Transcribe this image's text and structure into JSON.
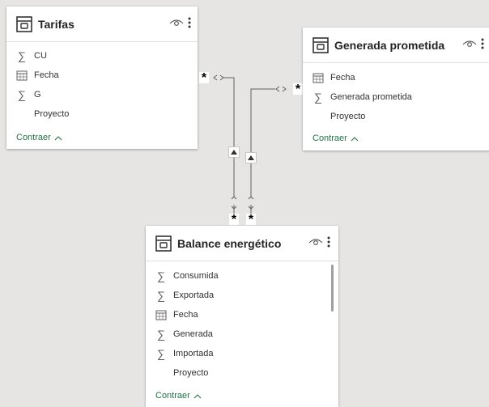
{
  "tables": {
    "tarifas": {
      "title": "Tarifas",
      "fields": [
        {
          "name": "CU",
          "icon": "sigma-icon"
        },
        {
          "name": "Fecha",
          "icon": "calendar-icon"
        },
        {
          "name": "G",
          "icon": "sigma-icon"
        },
        {
          "name": "Proyecto",
          "icon": "none"
        }
      ],
      "collapse_label": "Contraer"
    },
    "generada_prometida": {
      "title": "Generada prometida",
      "fields": [
        {
          "name": "Fecha",
          "icon": "calendar-icon"
        },
        {
          "name": "Generada prometida",
          "icon": "sigma-icon"
        },
        {
          "name": "Proyecto",
          "icon": "none"
        }
      ],
      "collapse_label": "Contraer"
    },
    "balance": {
      "title": "Balance energético",
      "fields": [
        {
          "name": "Consumida",
          "icon": "sigma-icon"
        },
        {
          "name": "Exportada",
          "icon": "sigma-icon"
        },
        {
          "name": "Fecha",
          "icon": "calendar-icon"
        },
        {
          "name": "Generada",
          "icon": "sigma-icon"
        },
        {
          "name": "Importada",
          "icon": "sigma-icon"
        },
        {
          "name": "Proyecto",
          "icon": "none"
        }
      ],
      "collapse_label": "Contraer"
    }
  },
  "relationships": {
    "many_symbol": "*"
  },
  "colors": {
    "canvas_bg": "#e6e5e4",
    "card_bg": "#ffffff",
    "collapse_link": "#217346",
    "line": "#605e5c"
  }
}
